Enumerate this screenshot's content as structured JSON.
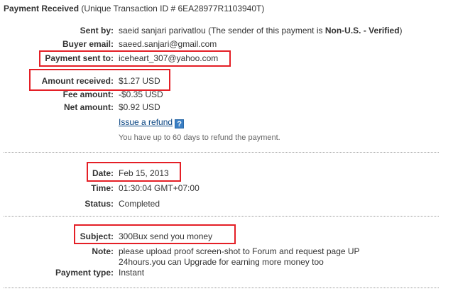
{
  "header": {
    "title": "Payment Received",
    "transaction_text": "(Unique Transaction ID # 6EA28977R1103940T)"
  },
  "section1": {
    "sent_by_label": "Sent by:",
    "sent_by_value": "saeid sanjari parivatlou",
    "sent_by_note_prefix": "(The sender of this payment is",
    "sent_by_status": "Non-U.S. - Verified",
    "sent_by_note_suffix": ")",
    "buyer_email_label": "Buyer email:",
    "buyer_email_value": "saeed.sanjari@gmail.com",
    "payment_sent_to_label": "Payment sent to:",
    "payment_sent_to_value": "iceheart_307@yahoo.com",
    "amount_received_label": "Amount received:",
    "amount_received_value": "$1.27 USD",
    "fee_amount_label": "Fee amount:",
    "fee_amount_value": "-$0.35 USD",
    "net_amount_label": "Net amount:",
    "net_amount_value": "$0.92 USD",
    "refund_link": "Issue a refund",
    "help_icon_glyph": "?",
    "refund_note": "You have up to 60 days to refund the payment."
  },
  "section2": {
    "date_label": "Date:",
    "date_value": "Feb 15, 2013",
    "time_label": "Time:",
    "time_value": "01:30:04 GMT+07:00",
    "status_label": "Status:",
    "status_value": "Completed"
  },
  "section3": {
    "subject_label": "Subject:",
    "subject_value": "300Bux send you money",
    "note_label": "Note:",
    "note_line1": "please upload proof screen-shot to Forum and request page UP",
    "note_line2": "24hours.you can Upgrade for earning more money too",
    "payment_type_label": "Payment type:",
    "payment_type_value": "Instant"
  },
  "colors": {
    "highlight_box": "#e41f26",
    "link": "#084482",
    "help_icon": "#3b7fc4"
  }
}
